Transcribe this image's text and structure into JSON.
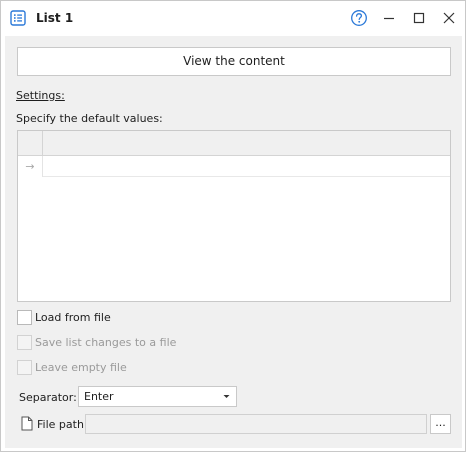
{
  "window": {
    "title": "List 1",
    "icons": {
      "app": "list-icon",
      "help": "help-icon",
      "minimize": "minimize-icon",
      "maximize": "maximize-icon",
      "close": "close-icon"
    },
    "accent_color": "#2b79d8"
  },
  "view_content_button": "View the content",
  "settings_label": "Settings:",
  "specify_label": "Specify the default values:",
  "grid": {
    "new_row_indicator": "→",
    "rows": [
      ""
    ]
  },
  "checkboxes": {
    "load_from_file": {
      "label": "Load from file",
      "checked": false,
      "enabled": true
    },
    "save_list_changes": {
      "label": "Save list changes to a file",
      "checked": false,
      "enabled": false
    },
    "leave_empty_file": {
      "label": "Leave empty file",
      "checked": false,
      "enabled": false
    }
  },
  "separator": {
    "label": "Separator:",
    "value": "Enter"
  },
  "file_path": {
    "label": "File path",
    "value": "",
    "browse_label": "..."
  }
}
